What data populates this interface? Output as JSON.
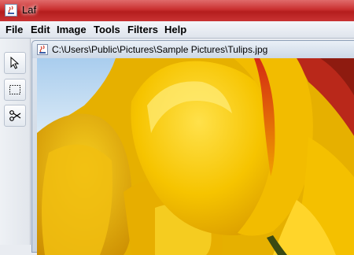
{
  "window": {
    "title": "Laf",
    "accent_color": "#c62f2f"
  },
  "menubar": {
    "items": [
      {
        "label": "File"
      },
      {
        "label": "Edit"
      },
      {
        "label": "Image"
      },
      {
        "label": "Tools"
      },
      {
        "label": "Filters"
      },
      {
        "label": "Help"
      }
    ]
  },
  "toolbar": {
    "tools": [
      {
        "name": "pointer",
        "icon": "arrow-cursor-icon"
      },
      {
        "name": "rectangle-select",
        "icon": "dashed-rectangle-icon"
      },
      {
        "name": "scissors",
        "icon": "scissors-icon"
      }
    ]
  },
  "document": {
    "title": "C:\\Users\\Public\\Pictures\\Sample Pictures\\Tulips.jpg",
    "image_subject": "tulips",
    "dominant_colors": [
      "#f5c300",
      "#e8a800",
      "#d94a1a",
      "#9cc3e8"
    ]
  }
}
